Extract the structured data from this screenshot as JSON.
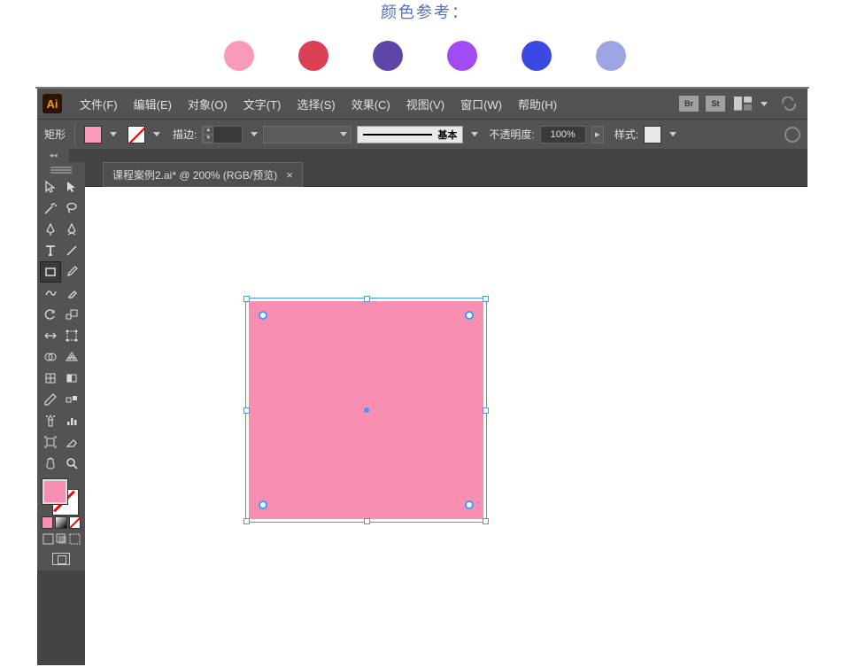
{
  "colorRef": {
    "title": "颜色参考：",
    "colors": [
      "#f59bb8",
      "#dc4055",
      "#5e45a8",
      "#a14bf2",
      "#3a48e4",
      "#9da5e2"
    ]
  },
  "app": {
    "logo": "Ai"
  },
  "menu": {
    "file": "文件(F)",
    "edit": "编辑(E)",
    "object": "对象(O)",
    "type": "文字(T)",
    "select": "选择(S)",
    "effect": "效果(C)",
    "view": "视图(V)",
    "window": "窗口(W)",
    "help": "帮助(H)",
    "br": "Br",
    "st": "St"
  },
  "control": {
    "shape": "矩形",
    "fillColor": "#f99cbc",
    "strokeLabel": "描边:",
    "strokeWeight": "",
    "brushLabel": "基本",
    "opacityLabel": "不透明度:",
    "opacityValue": "100%",
    "styleLabel": "样式:"
  },
  "document": {
    "tabTitle": "课程案例2.ai* @ 200% (RGB/预览)",
    "close": "×"
  },
  "shape": {
    "color": "#f78fb3"
  }
}
